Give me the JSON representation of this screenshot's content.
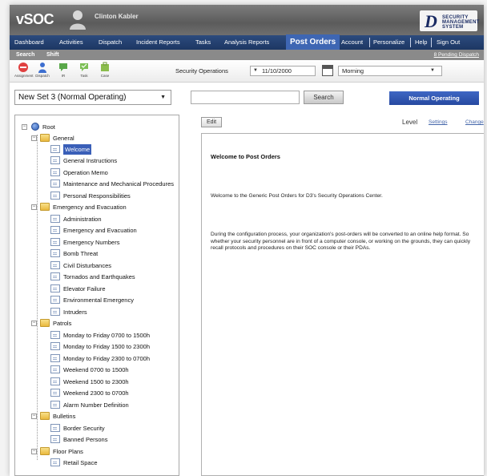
{
  "header": {
    "app_title": "vSOC",
    "user_name": "Clinton Kabler",
    "brand_letter": "D",
    "brand_lines": [
      "SECURITY",
      "MANAGEMENT",
      "SYSTEM"
    ]
  },
  "nav": {
    "items": [
      {
        "label": "Dashboard"
      },
      {
        "label": "Activities"
      },
      {
        "label": "Dispatch"
      },
      {
        "label": "Incident Reports"
      },
      {
        "label": "Tasks"
      },
      {
        "label": "Analysis Reports"
      },
      {
        "label": "Post Orders"
      },
      {
        "label": "Account"
      },
      {
        "label": "Personalize"
      },
      {
        "label": "Help"
      },
      {
        "label": "Sign Out"
      }
    ],
    "active": "Post Orders"
  },
  "subnav": {
    "items": [
      {
        "label": "Search"
      },
      {
        "label": "Shift"
      }
    ],
    "pending_link": "8 Pending Dispatch"
  },
  "toolbar": {
    "tools": [
      {
        "label": "Assignment",
        "icon": "assignment-icon"
      },
      {
        "label": "Dispatch",
        "icon": "dispatch-icon"
      },
      {
        "label": "IR",
        "icon": "ir-icon"
      },
      {
        "label": "Task",
        "icon": "task-icon"
      },
      {
        "label": "Case",
        "icon": "case-icon"
      }
    ],
    "location_label": "Security Operations",
    "date_value": "11/10/2000",
    "shift_value": "Morning"
  },
  "controls": {
    "set_select": "New Set 3 (Normal Operating)",
    "search_value": "",
    "search_button": "Search",
    "status_button": "Normal Operating"
  },
  "tree": {
    "root": "Root",
    "folders": [
      {
        "label": "General",
        "items": [
          "Welcome",
          "General Instructions",
          "Operation Memo",
          "Maintenance and Mechanical Procedures",
          "Personal Responsibilities"
        ]
      },
      {
        "label": "Emergency and Evacuation",
        "items": [
          "Administration",
          "Emergency and Evacuation",
          "Emergency Numbers",
          "Bomb Threat",
          "Civil Disturbances",
          "Tornados and Earthquakes",
          "Elevator Failure",
          "Environmental Emergency",
          "Intruders"
        ]
      },
      {
        "label": "Patrols",
        "items": [
          "Monday to Friday 0700 to 1500h",
          "Monday to Friday 1500 to 2300h",
          "Monday to Friday 2300 to 0700h",
          "Weekend 0700 to 1500h",
          "Weekend 1500 to 2300h",
          "Weekend 2300 to 0700h",
          "Alarm Number Definition"
        ]
      },
      {
        "label": "Bulletins",
        "items": [
          "Border Security",
          "Banned Persons"
        ]
      },
      {
        "label": "Floor Plans",
        "items": [
          "Retail Space"
        ]
      }
    ],
    "selected": "Welcome"
  },
  "content": {
    "edit_button": "Edit",
    "level_label": "Level",
    "settings_link": "Settings",
    "change_link": "Change",
    "title": "Welcome to Post Orders",
    "paragraph1": "Welcome to the Generic Post Orders for D3's Security Operations Center.",
    "paragraph2": "During the configuration process, your organization's post-orders will be converted to an online help format. So whether your security personnel are in front of a computer console, or working on the grounds, they can quickly recall protocols and procedures on their SOC console or their PDAs."
  },
  "colors": {
    "nav_bg": "#1d3763",
    "nav_active": "#3e66b3",
    "status_button": "#2649a0",
    "tree_selected": "#3a5fb8"
  }
}
